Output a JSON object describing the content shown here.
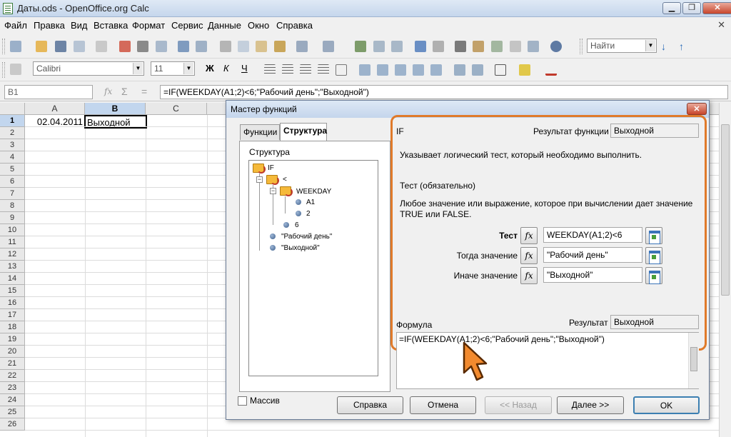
{
  "window": {
    "title": "Даты.ods - OpenOffice.org Calc",
    "minimize": "▁",
    "maximize": "❐",
    "close": "✕"
  },
  "menu": [
    "Файл",
    "Правка",
    "Вид",
    "Вставка",
    "Формат",
    "Сервис",
    "Данные",
    "Окно",
    "Справка"
  ],
  "menu_close": "✕",
  "toolbar": {
    "find_placeholder": "Найти",
    "font_name": "Calibri",
    "font_size": "11",
    "bold": "Ж",
    "italic": "К",
    "underline": "Ч"
  },
  "formula_bar": {
    "name_box": "B1",
    "formula": "=IF(WEEKDAY(A1;2)<6;\"Рабочий день\";\"Выходной\")"
  },
  "sheet": {
    "columns": [
      "A",
      "B",
      "C"
    ],
    "rows": [
      "1",
      "2",
      "3",
      "4",
      "5",
      "6",
      "7",
      "8",
      "9",
      "10",
      "11",
      "12",
      "13",
      "14",
      "15",
      "16",
      "17",
      "18",
      "19",
      "20",
      "21",
      "22",
      "23",
      "24",
      "25",
      "26"
    ],
    "a1": "02.04.2011",
    "b1": "Выходной"
  },
  "dialog": {
    "title": "Мастер функций",
    "close": "✕",
    "tabs": [
      "Функции",
      "Структура"
    ],
    "structure_label": "Структура",
    "tree": {
      "if": "IF",
      "lt": "<",
      "weekday": "WEEKDAY",
      "a1": "A1",
      "two": "2",
      "six": "6",
      "workday": "\"Рабочий день\"",
      "weekend": "\"Выходной\""
    },
    "function_name": "IF",
    "result_label": "Результат функции",
    "result_value": "Выходной",
    "description": "Указывает логический тест, который необходимо выполнить.",
    "arg_title": "Тест (обязательно)",
    "arg_description": "Любое значение или выражение, которое при вычислении дает значение TRUE или FALSE.",
    "args": [
      {
        "label": "Тест",
        "value": "WEEKDAY(A1;2)<6"
      },
      {
        "label": "Тогда значение",
        "value": "\"Рабочий день\""
      },
      {
        "label": "Иначе значение",
        "value": "\"Выходной\""
      }
    ],
    "fx": "fx",
    "formula_label": "Формула",
    "formula_result_label": "Результат",
    "formula_result_value": "Выходной",
    "formula": "=IF(WEEKDAY(A1;2)<6;\"Рабочий день\";\"Выходной\")",
    "array_label": "Массив",
    "buttons": {
      "help": "Справка",
      "cancel": "Отмена",
      "back": "<< Назад",
      "next": "Далее >>",
      "ok": "OK"
    }
  },
  "colors": {
    "highlight": "#e07a2a",
    "header_selected": "#c2d6ee"
  }
}
